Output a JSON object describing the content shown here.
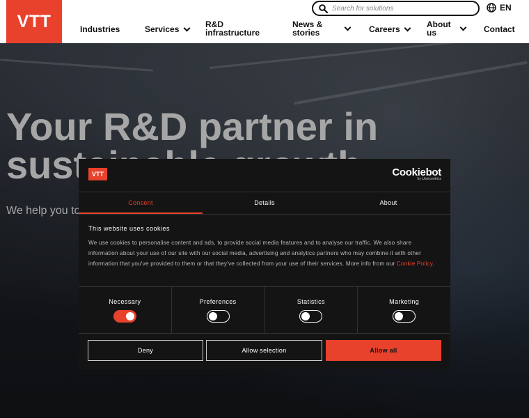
{
  "header": {
    "logo_text": "VTT",
    "search_placeholder": "Search for solutions",
    "language": "EN",
    "nav": [
      {
        "label": "Industries"
      },
      {
        "label": "Services"
      },
      {
        "label_line1": "R&D",
        "label_line2": "infrastructure"
      },
      {
        "label_line1": "News &",
        "label_line2": "stories"
      },
      {
        "label": "Careers"
      },
      {
        "label_line1": "About",
        "label_line2": "us"
      },
      {
        "label": "Contact"
      }
    ]
  },
  "hero": {
    "title_line1": "Your R&D partner in",
    "title_line2": "sustainable growth",
    "subtitle": "We help you to"
  },
  "cookie": {
    "logo_text": "VTT",
    "brand": "Cookiebot",
    "brand_by": "by Usercentrics",
    "tabs": [
      "Consent",
      "Details",
      "About"
    ],
    "heading": "This website uses cookies",
    "body": "We use cookies to personalise content and ads, to provide social media features and to analyse our traffic. We also share information about your use of our site with our social media, advertising and analytics partners who may combine it with other information that you've provided to them or that they've collected from your use of their services. More info from our ",
    "policy_link": "Cookie Policy",
    "body_end": ".",
    "toggles": [
      {
        "label": "Necessary",
        "on": true
      },
      {
        "label": "Preferences",
        "on": false
      },
      {
        "label": "Statistics",
        "on": false
      },
      {
        "label": "Marketing",
        "on": false
      }
    ],
    "buttons": {
      "deny": "Deny",
      "allow_selection": "Allow selection",
      "allow_all": "Allow all"
    }
  },
  "colors": {
    "brand_red": "#e8412c",
    "dialog_bg": "#141414"
  }
}
